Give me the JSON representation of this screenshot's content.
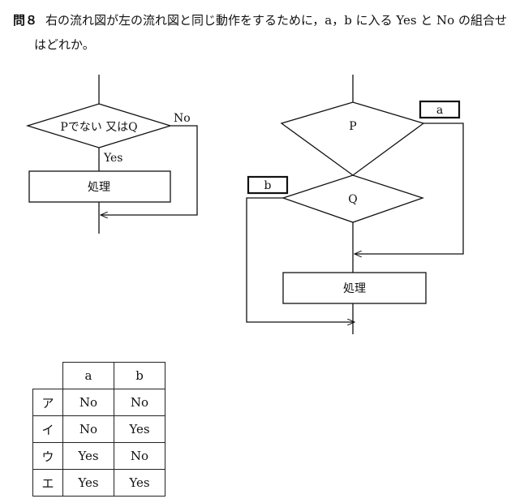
{
  "question": {
    "number": "問８",
    "line1": "右の流れ図が左の流れ図と同じ動作をするために，a，b に入る Yes と No の組合せ",
    "line2": "はどれか。"
  },
  "left_flow": {
    "condition": "Pでない 又はQ",
    "no_label": "No",
    "yes_label": "Yes",
    "process": "処理"
  },
  "right_flow": {
    "condition_p": "P",
    "condition_q": "Q",
    "box_a": "a",
    "box_b": "b",
    "process": "処理"
  },
  "answer_table": {
    "headers": [
      "a",
      "b"
    ],
    "rows": [
      {
        "label": "ア",
        "a": "No",
        "b": "No"
      },
      {
        "label": "イ",
        "a": "No",
        "b": "Yes"
      },
      {
        "label": "ウ",
        "a": "Yes",
        "b": "No"
      },
      {
        "label": "エ",
        "a": "Yes",
        "b": "Yes"
      }
    ]
  }
}
